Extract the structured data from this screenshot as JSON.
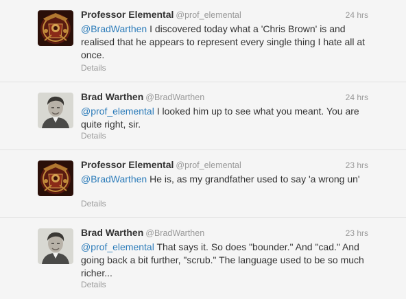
{
  "tweets": [
    {
      "fullname": "Professor Elemental",
      "username": "@prof_elemental",
      "time": "24 hrs",
      "mention": "@BradWarthen",
      "text": " I discovered today what a 'Chris Brown' is and realised that he appears to represent every single thing I hate all at once.",
      "details": "Details",
      "avatar": "steampunk-emblem-avatar"
    },
    {
      "fullname": "Brad Warthen",
      "username": "@BradWarthen",
      "time": "24 hrs",
      "mention": "@prof_elemental",
      "text": " I looked him up to see what you meant. You are quite right, sir.",
      "details": "Details",
      "avatar": "portrait-avatar"
    },
    {
      "fullname": "Professor Elemental",
      "username": "@prof_elemental",
      "time": "23 hrs",
      "mention": "@BradWarthen",
      "text": " He is, as my grandfather used to say 'a wrong un'",
      "details": "Details",
      "avatar": "steampunk-emblem-avatar"
    },
    {
      "fullname": "Brad Warthen",
      "username": "@BradWarthen",
      "time": "23 hrs",
      "mention": "@prof_elemental",
      "text": " That says it. So does \"bounder.\" And \"cad.\" And going back a bit further, \"scrub.\" The language used to be so much richer...",
      "details": "Details",
      "avatar": "portrait-avatar"
    }
  ],
  "colors": {
    "background": "#f5f5f5",
    "link": "#2b7bb9",
    "text": "#333333",
    "muted": "#999999"
  }
}
